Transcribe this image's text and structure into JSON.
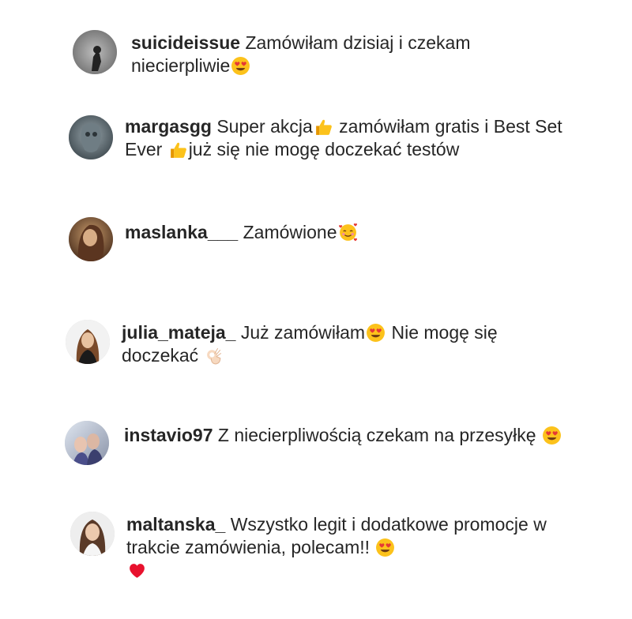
{
  "comments": [
    {
      "username": "suicideissue",
      "parts": [
        "Zamówiłam dzisiaj i czekam niecierpliwie"
      ],
      "emojis": [
        "heart-eyes-emoji"
      ]
    },
    {
      "username": "margasgg",
      "parts": [
        "Super akcja",
        " zamówiłam gratis i Best Set Ever ",
        "już się nie mogę doczekać testów"
      ],
      "emojis": [
        "thumbs-up-emoji",
        "thumbs-up-emoji"
      ]
    },
    {
      "username": "maslanka___",
      "parts": [
        "Zamówione"
      ],
      "emojis": [
        "smiling-face-with-hearts-emoji"
      ]
    },
    {
      "username": "julia_mateja_",
      "parts": [
        "Już zamówiłam",
        " Nie mogę się doczekać "
      ],
      "emojis": [
        "heart-eyes-emoji",
        "ok-hand-emoji"
      ]
    },
    {
      "username": "instavio97",
      "parts": [
        "Z niecierpliwością czekam na przesyłkę "
      ],
      "emojis": [
        "heart-eyes-emoji"
      ]
    },
    {
      "username": "maltanska_",
      "parts": [
        "Wszystko legit i dodatkowe promocje w trakcie zamówienia, polecam!! "
      ],
      "emojis": [
        "heart-eyes-emoji",
        "red-heart-emoji"
      ]
    }
  ]
}
